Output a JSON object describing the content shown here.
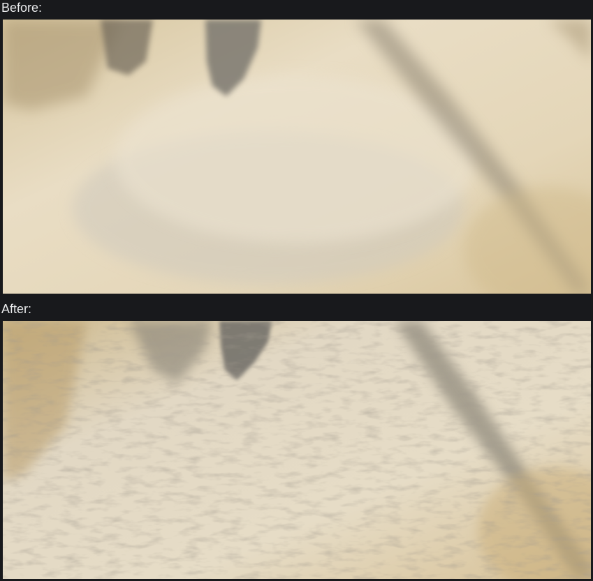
{
  "comparison": {
    "before_label": "Before:",
    "after_label": "After:"
  },
  "colors": {
    "page_background": "#18191c",
    "label_text": "#e9eaec",
    "sand_light": "#e8dcc2",
    "sand_mid": "#d9c9a6",
    "sand_shadow": "#8f8a7c"
  },
  "images": {
    "before": {
      "subject": "blurred-sand-dune-terrain"
    },
    "after": {
      "subject": "detailed-rippled-sand-dune-terrain"
    }
  }
}
